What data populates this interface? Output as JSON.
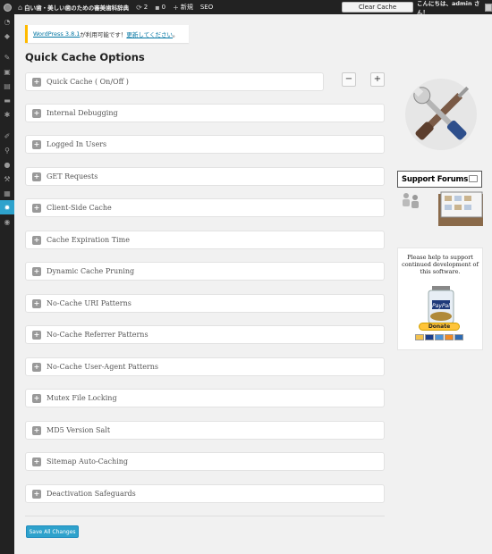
{
  "adminbar": {
    "site_name": "白い歯・美しい歯のための審美歯科辞典",
    "updates_count": "2",
    "comments_count": "0",
    "new_label": "新規",
    "seo_label": "SEO",
    "clear_cache_label": "Clear Cache",
    "howdy": "こんにちは、admin さん！"
  },
  "notice": {
    "version_link": "WordPress 3.8.1",
    "middle_text": " が利用可能です！",
    "update_link": "更新してください",
    "end_text": "。"
  },
  "page_title": "Quick Cache Options",
  "controls": {
    "collapse_symbol": "−",
    "expand_symbol": "+"
  },
  "panels": [
    "Quick Cache ( On/Off )",
    "Internal Debugging",
    "Logged In Users",
    "GET Requests",
    "Client-Side Cache",
    "Cache Expiration Time",
    "Dynamic Cache Pruning",
    "No-Cache URI Patterns",
    "No-Cache Referrer Patterns",
    "No-Cache User-Agent Patterns",
    "Mutex File Locking",
    "MD5 Version Salt",
    "Sitemap Auto-Caching",
    "Deactivation Safeguards"
  ],
  "panel_toggle_symbol": "+",
  "save_button": "Save All Changes",
  "sidebar": {
    "support_label": "Support Forums",
    "donate_message": "Please help to support continued development of this software.",
    "paypal_text": "PayPal",
    "donate_label": "Donate"
  },
  "colors": {
    "accent": "#2ea2cc",
    "adminbar": "#222222",
    "notice_border": "#ffba00"
  },
  "icons": {
    "adminbar": [
      "wordpress-logo-icon",
      "refresh-icon",
      "comment-icon",
      "plus-icon"
    ],
    "menu": [
      "dashboard-icon",
      "jetpack-icon",
      "pin-icon",
      "media-icon",
      "pages-icon",
      "comments-icon",
      "settings-icon",
      "appearance-icon",
      "plugins-icon",
      "users-icon",
      "tools-icon",
      "table-icon",
      "quick-cache-gear-icon",
      "collapse-icon"
    ]
  }
}
